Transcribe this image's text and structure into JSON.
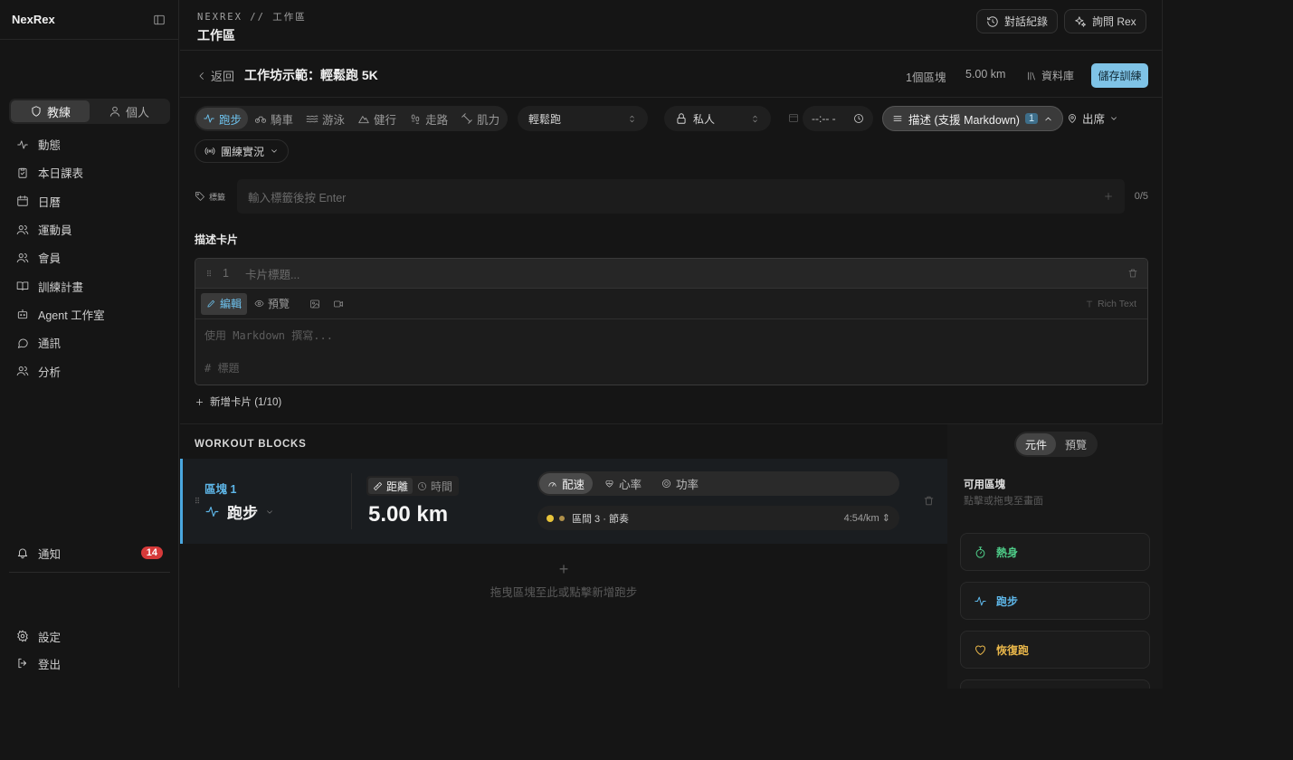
{
  "sidebar": {
    "brand": "NexRex",
    "roles": [
      "教練",
      "個人"
    ],
    "nav": [
      {
        "label": "動態",
        "icon": "activity-icon"
      },
      {
        "label": "本日課表",
        "icon": "clipboard-icon"
      },
      {
        "label": "日曆",
        "icon": "calendar-icon"
      },
      {
        "label": "運動員",
        "icon": "users-icon"
      },
      {
        "label": "會員",
        "icon": "members-icon"
      },
      {
        "label": "訓練計畫",
        "icon": "book-icon"
      },
      {
        "label": "Agent 工作室",
        "icon": "bot-icon"
      },
      {
        "label": "通訊",
        "icon": "chat-icon"
      },
      {
        "label": "分析",
        "icon": "analytics-icon"
      }
    ],
    "notifications": {
      "label": "通知",
      "count": "14"
    },
    "settings": "設定",
    "logout": "登出"
  },
  "header": {
    "breadcrumb": "NEXREX // 工作區",
    "title": "工作區",
    "history_btn": "對話紀錄",
    "ask_btn": "詢問 Rex"
  },
  "subbar": {
    "back": "返回",
    "title": "工作坊示範：輕鬆跑 5K",
    "blocks": "1個區塊",
    "distance": "5.00 km",
    "library": "資料庫",
    "save": "儲存訓練"
  },
  "options": {
    "sports": [
      "跑步",
      "騎車",
      "游泳",
      "健行",
      "走路",
      "肌力"
    ],
    "type": "輕鬆跑",
    "visibility": "私人",
    "time": "--:-- -",
    "description_btn": "描述 (支援 Markdown)",
    "description_count": "1",
    "attendance": "出席",
    "live": "團練實況"
  },
  "tags": {
    "label": "標籤",
    "placeholder": "輸入標籤後按 Enter",
    "count": "0/5"
  },
  "desc_cards": {
    "section_title": "描述卡片",
    "card_index": "1",
    "card_title_placeholder": "卡片標題...",
    "edit_tab": "編輯",
    "preview_tab": "預覽",
    "rich_text": "Rich Text",
    "md_line1": "使用 Markdown 撰寫...",
    "md_line2": "# 標題",
    "add_card": "新增卡片 (1/10)"
  },
  "workout": {
    "section_title": "WORKOUT BLOCKS",
    "block_label": "區塊 1",
    "block_sport": "跑步",
    "mode_distance": "距離",
    "mode_time": "時間",
    "value": "5.00 km",
    "targets": [
      "配速",
      "心率",
      "功率"
    ],
    "zone_label": "區間 3 · 節奏",
    "zone_pace": "4:54/km",
    "drop_hint": "拖曳區塊至此或點擊新增跑步"
  },
  "right_panel": {
    "tabs": [
      "元件",
      "預覽"
    ],
    "available_title": "可用區塊",
    "available_sub": "點擊或拖曳至畫面",
    "items": [
      {
        "label": "熱身",
        "color": "#4fcf8a"
      },
      {
        "label": "跑步",
        "color": "#5eb7e9"
      },
      {
        "label": "恢復跑",
        "color": "#e8b64a"
      }
    ]
  },
  "colors": {
    "accent": "#6ec3ef",
    "save": "#7fc3e6",
    "badge": "#d63a3a",
    "zone_dot_1": "#e8c43a",
    "zone_dot_2": "#b0904a"
  }
}
